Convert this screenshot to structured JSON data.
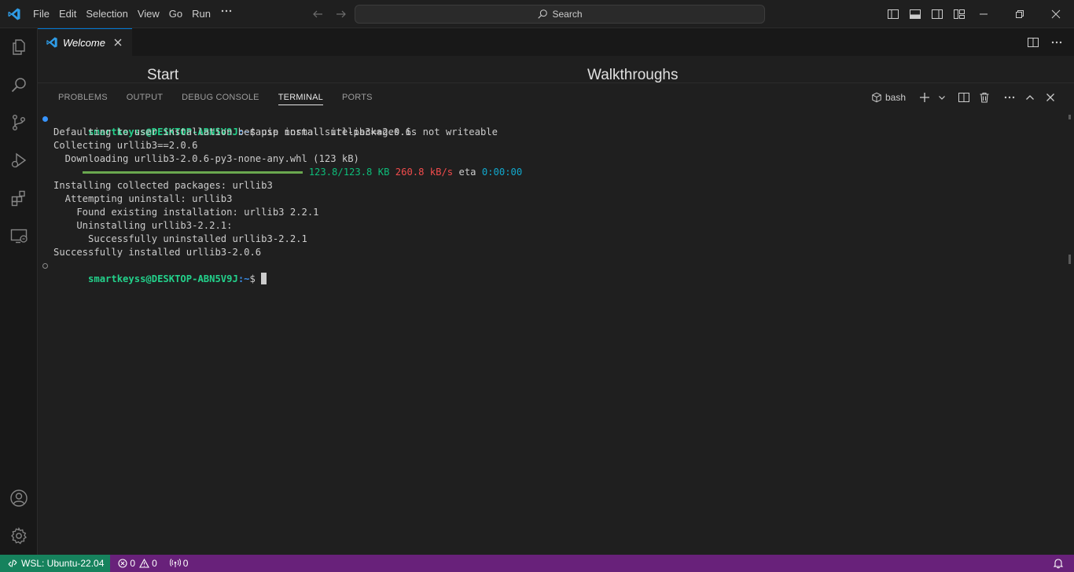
{
  "titlebar": {
    "menu": [
      "File",
      "Edit",
      "Selection",
      "View",
      "Go",
      "Run"
    ],
    "search_label": "Search"
  },
  "activitybar": {
    "items": [
      "explorer-icon",
      "search-icon",
      "source-control-icon",
      "run-debug-icon",
      "extensions-icon",
      "remote-explorer-icon"
    ],
    "bottom": [
      "accounts-icon",
      "manage-gear-icon"
    ]
  },
  "editor": {
    "tab_label": "Welcome",
    "welcome_start": "Start",
    "welcome_walkthroughs": "Walkthroughs"
  },
  "panel": {
    "tabs": [
      "PROBLEMS",
      "OUTPUT",
      "DEBUG CONSOLE",
      "TERMINAL",
      "PORTS"
    ],
    "active_tab": "TERMINAL",
    "shell_label": "bash"
  },
  "terminal": {
    "prompt_user": "smartkeyss@DESKTOP-ABN5V9J",
    "prompt_path": ":~",
    "prompt_symbol": "$ ",
    "command": "pip install urllib3==2.0.6",
    "lines": [
      "Defaulting to user installation because normal site-packages is not writeable",
      "Collecting urllib3==2.0.6",
      "  Downloading urllib3-2.0.6-py3-none-any.whl (123 kB)"
    ],
    "progress": {
      "fraction": 1.0,
      "size": "123.8/123.8 KB",
      "speed": "260.8 kB/s",
      "eta_label": "eta",
      "eta": "0:00:00"
    },
    "lines_after": [
      "Installing collected packages: urllib3",
      "  Attempting uninstall: urllib3",
      "    Found existing installation: urllib3 2.2.1",
      "    Uninstalling urllib3-2.2.1:",
      "      Successfully uninstalled urllib3-2.2.1",
      "Successfully installed urllib3-2.0.6"
    ]
  },
  "statusbar": {
    "remote_label": "WSL: Ubuntu-22.04",
    "errors": "0",
    "warnings": "0",
    "ports": "0"
  },
  "colors": {
    "statusbar_bg": "#68217a",
    "remote_bg": "#16825d",
    "accent": "#0078d4",
    "prompt_green": "#23d18b",
    "prompt_blue": "#3b8eea"
  }
}
